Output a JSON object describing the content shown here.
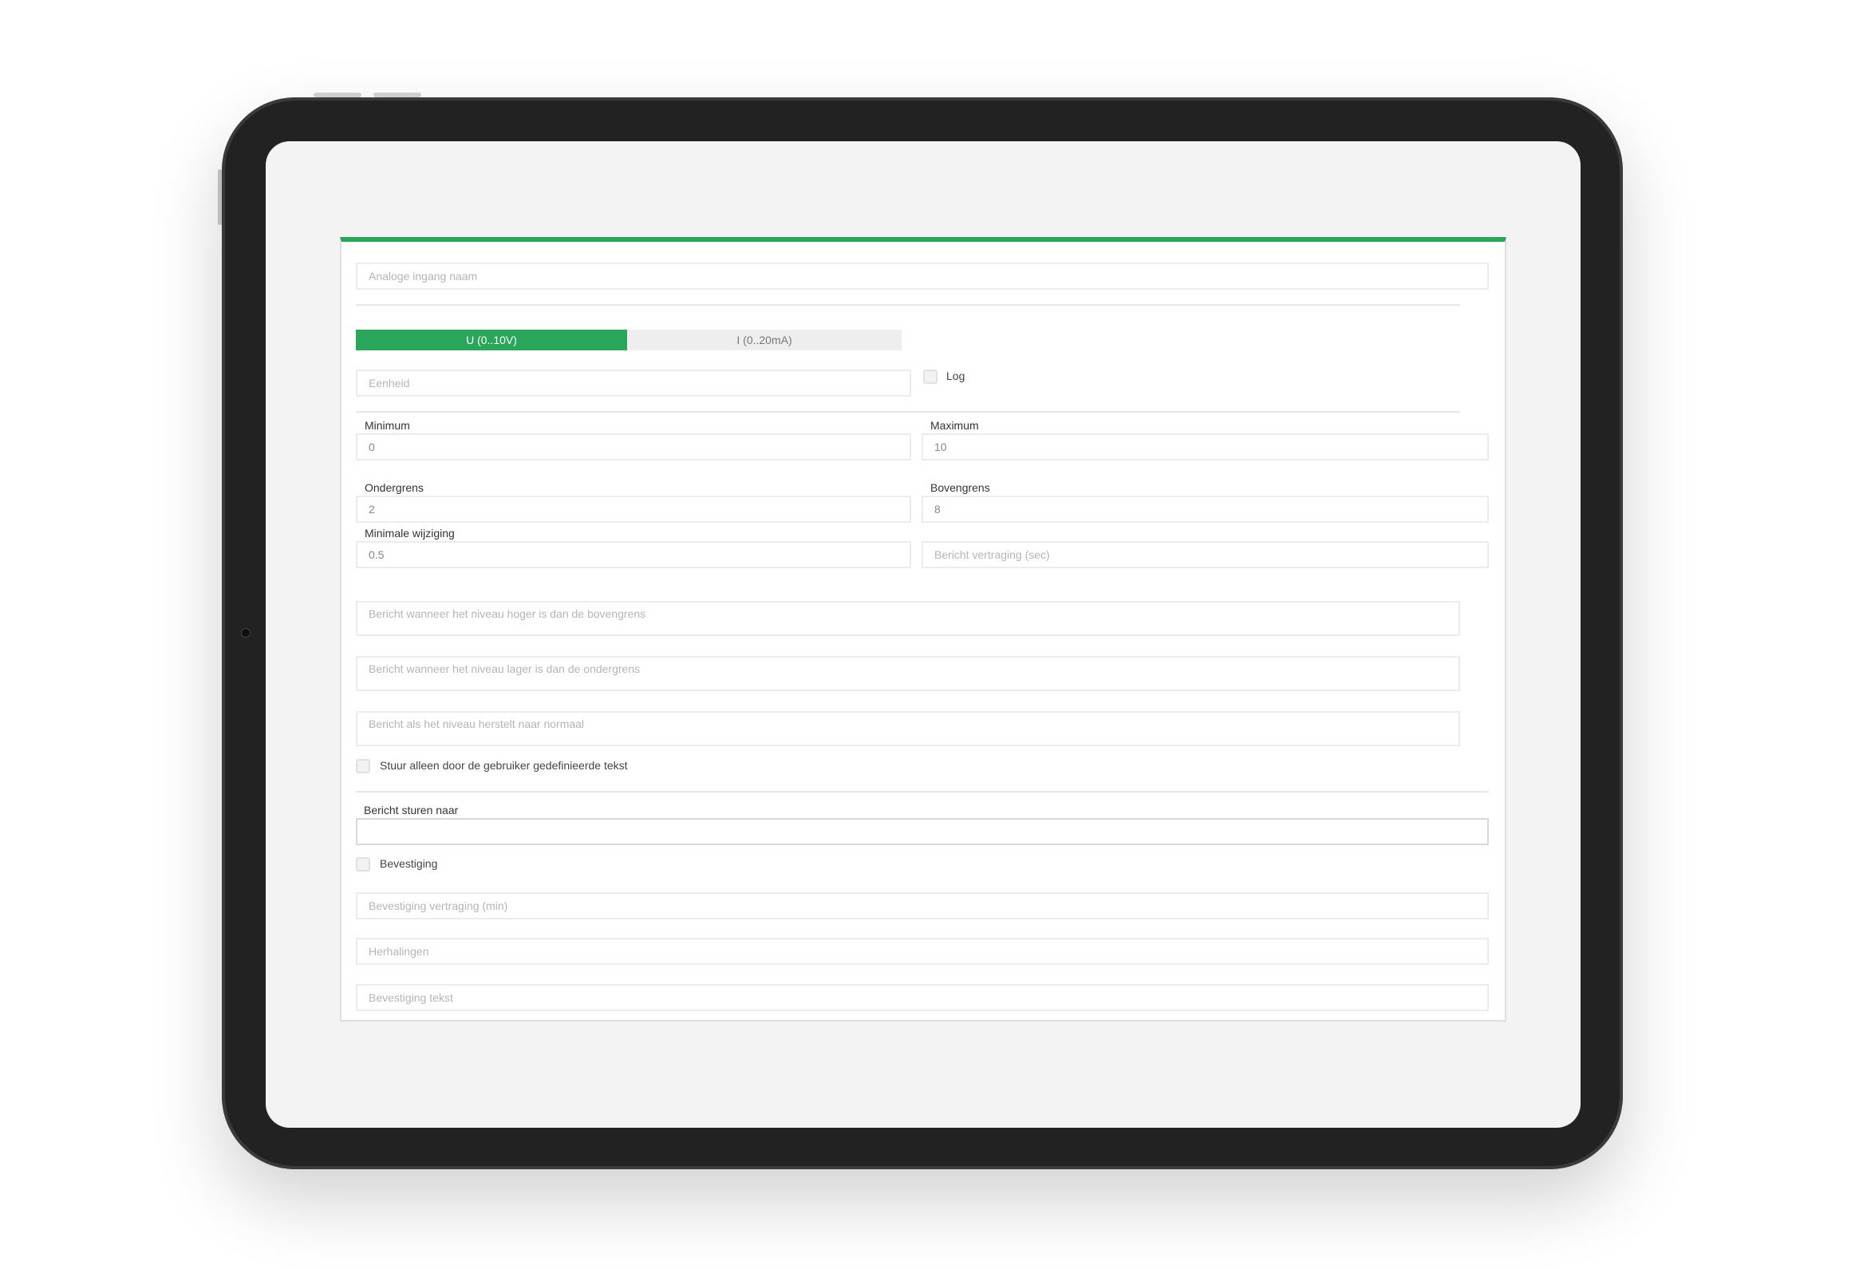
{
  "form": {
    "name_placeholder": "Analoge ingang naam",
    "mode_tabs": [
      {
        "label": "U (0..10V)",
        "active": true
      },
      {
        "label": "I (0..20mA)",
        "active": false
      }
    ],
    "unit_placeholder": "Eenheid",
    "log_label": "Log",
    "minimum_label": "Minimum",
    "minimum_value": "0",
    "maximum_label": "Maximum",
    "maximum_value": "10",
    "lower_limit_label": "Ondergrens",
    "lower_limit_value": "2",
    "upper_limit_label": "Bovengrens",
    "upper_limit_value": "8",
    "min_change_label": "Minimale wijziging",
    "min_change_value": "0.5",
    "message_delay_placeholder": "Bericht vertraging (sec)",
    "msg_high_placeholder": "Bericht wanneer het niveau hoger is dan de bovengrens",
    "msg_low_placeholder": "Bericht wanneer het niveau lager is dan de ondergrens",
    "msg_normal_placeholder": "Bericht als het niveau herstelt naar normaal",
    "user_text_only_label": "Stuur alleen door de gebruiker gedefinieerde tekst",
    "send_to_label": "Bericht sturen naar",
    "send_to_value": "",
    "confirmation_label": "Bevestiging",
    "confirmation_delay_placeholder": "Bevestiging vertraging (min)",
    "repetitions_placeholder": "Herhalingen",
    "confirmation_text_placeholder": "Bevestiging tekst"
  },
  "colors": {
    "accent": "#2aa65a",
    "bezel": "#222222",
    "screen": "#f3f3f3"
  }
}
